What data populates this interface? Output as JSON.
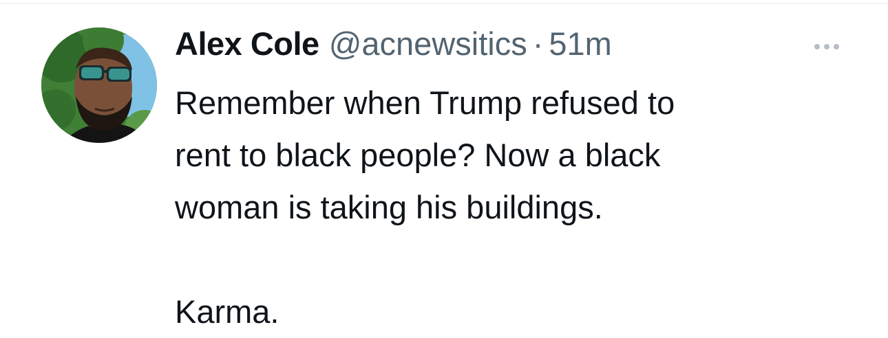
{
  "tweet": {
    "author": {
      "display_name": "Alex Cole",
      "handle": "@acnewsitics",
      "avatar_icon": "profile-photo-sunglasses-man"
    },
    "separator": "·",
    "time_ago": "51m",
    "more_icon": "ellipsis-horizontal-icon",
    "text": "Remember when Trump refused to\nrent to black people? Now a black\nwoman is taking his buildings.\n\nKarma."
  },
  "colors": {
    "text_primary": "#0f1419",
    "text_secondary": "#536471",
    "divider": "#e6e9ec"
  }
}
